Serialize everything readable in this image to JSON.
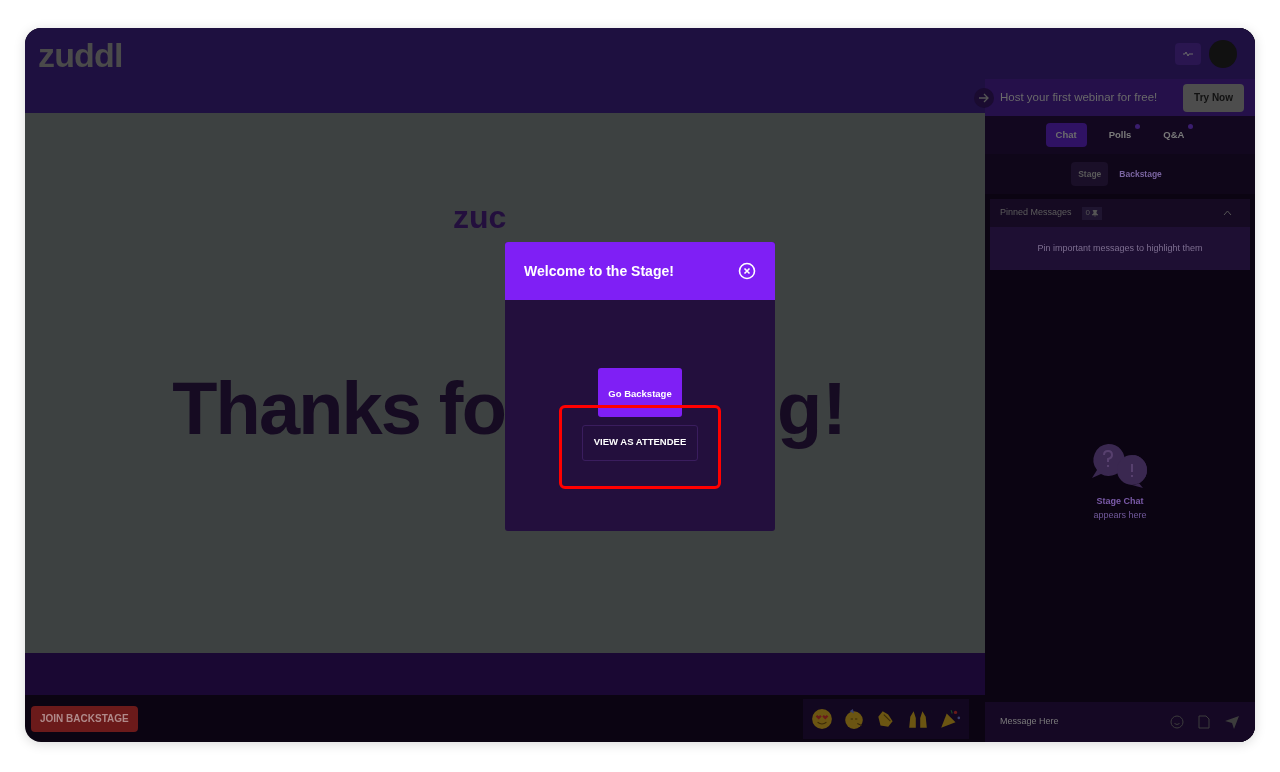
{
  "header": {
    "logo": "zuddl"
  },
  "promo": {
    "text": "Host your first webinar for free!",
    "button": "Try Now"
  },
  "tabs": [
    {
      "label": "Chat",
      "selected": true,
      "badge": false
    },
    {
      "label": "Polls",
      "selected": false,
      "badge": true
    },
    {
      "label": "Q&A",
      "selected": false,
      "badge": true
    }
  ],
  "subtabs": [
    {
      "label": "Stage",
      "selected": true
    },
    {
      "label": "Backstage",
      "selected": false
    }
  ],
  "pinned": {
    "title": "Pinned Messages",
    "count": "0",
    "expanded": true,
    "empty_text": "Pin important messages to highlight them"
  },
  "chat_empty": {
    "title": "Stage Chat",
    "subtitle": "appears here"
  },
  "message_field": {
    "placeholder": "Message Here"
  },
  "stage": {
    "logo_fragment": "zuc",
    "text_left": "Thanks fo",
    "text_right": "g!"
  },
  "bottom_bar": {
    "join_button": "JOIN BACKSTAGE",
    "reactions": [
      {
        "kind": "heart-eyes"
      },
      {
        "kind": "party-face"
      },
      {
        "kind": "clap"
      },
      {
        "kind": "raised-hands"
      },
      {
        "kind": "popper"
      }
    ]
  },
  "modal": {
    "title": "Welcome to the Stage!",
    "primary_button": "Go Backstage",
    "secondary_button": "VIEW AS ATTENDEE",
    "highlighted": true
  }
}
